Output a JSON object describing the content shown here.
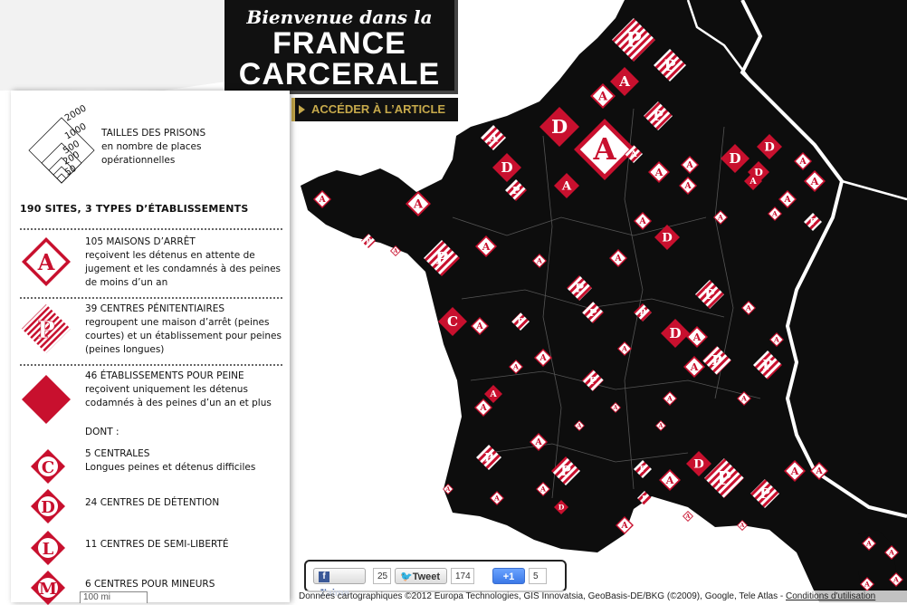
{
  "title": {
    "line1": "Bienvenue dans la",
    "line2": "FRANCE",
    "line3": "CARCERALE"
  },
  "access_button": {
    "label": "ACCÉDER À L’ARTICLE"
  },
  "legend": {
    "sizes": {
      "scale_labels": [
        "2000",
        "1000",
        "500",
        "200",
        "50"
      ],
      "line1": "TAILLES DES PRISONS",
      "line2": "en nombre de places",
      "line3": "opérationnelles"
    },
    "count_title": "190 SITES, 3 TYPES D’ÉTABLISSEMENTS",
    "entries": [
      {
        "letter": "A",
        "head": "105 MAISONS D’ARRÊT",
        "desc": "reçoivent les détenus en attente de jugement et les condamnés à des peines de moins d’un an"
      },
      {
        "letter": "P",
        "head": "39 CENTRES PÉNITENTIAIRES",
        "desc": "regroupent une maison d’arrêt (peines courtes) et un établissement pour peines (peines longues)"
      },
      {
        "letter": "",
        "head": "46 ÉTABLISSEMENTS POUR PEINE",
        "desc": "reçoivent uniquement les détenus codamnés à des peines d’un an et plus"
      }
    ],
    "dont_label": "DONT :",
    "sub_entries": [
      {
        "letter": "C",
        "head": "5 CENTRALES",
        "desc": "Longues peines et détenus difficiles"
      },
      {
        "letter": "D",
        "head": "24 CENTRES DE DÉTENTION",
        "desc": ""
      },
      {
        "letter": "L",
        "head": "11 CENTRES DE SEMI-LIBERTÉ",
        "desc": ""
      },
      {
        "letter": "M",
        "head": "6 CENTRES POUR MINEURS",
        "desc": ""
      }
    ]
  },
  "social": {
    "like_label": "J'aime",
    "like_count": "25",
    "tweet_label": "Tweet",
    "tweet_count": "174",
    "plus_label": "+1",
    "plus_count": "5"
  },
  "map": {
    "attribution": "Données cartographiques ©2012 Europa Technologies, GIS Innovatsia, GeoBasis-DE/BKG (©2009), Google, Tele Atlas -",
    "terms_link": "Conditions d'utilisation",
    "scale_label": "100 mi",
    "markers": [
      {
        "letter": "A"
      },
      {
        "letter": "P"
      },
      {
        "letter": "D"
      },
      {
        "letter": "C"
      },
      {
        "letter": "L"
      }
    ]
  },
  "colors": {
    "accent": "#c8102e",
    "title_bg": "#111111",
    "gold": "#c6a94b",
    "land": "#0d0d0d"
  }
}
